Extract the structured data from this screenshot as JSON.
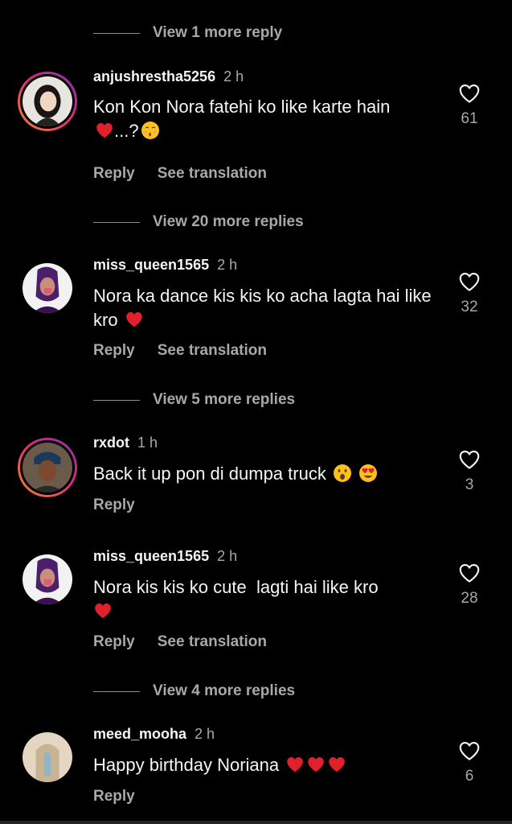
{
  "threads": [
    {
      "view_more": "View 1 more reply"
    },
    {
      "view_more": "View 20 more replies"
    },
    {
      "view_more": "View 5 more replies"
    },
    {
      "view_more": "View 4 more replies"
    }
  ],
  "comments": [
    {
      "username": "anjushrestha5256",
      "time": "2 h",
      "text_line1": "Kon Kon Nora fatehi ko like karte hain",
      "text_line2": "...?",
      "emojis": [
        "red-heart",
        "kissing-face-with-closed-eyes"
      ],
      "likes": "61",
      "reply": "Reply",
      "translate": "See translation",
      "avatar_ring": true
    },
    {
      "username": "miss_queen1565",
      "time": "2 h",
      "text": "Nora ka dance kis kis ko acha lagta hai like kro",
      "emojis": [
        "red-heart"
      ],
      "likes": "32",
      "reply": "Reply",
      "translate": "See translation",
      "avatar_ring": false
    },
    {
      "username": "rxdot",
      "time": "1 h",
      "text": "Back it up pon di dumpa truck",
      "emojis": [
        "face-with-open-mouth",
        "smiling-face-with-heart-eyes"
      ],
      "likes": "3",
      "reply": "Reply",
      "avatar_ring": true
    },
    {
      "username": "miss_queen1565",
      "time": "2 h",
      "text": "Nora kis kis ko cute  lagti hai like kro",
      "emojis": [
        "red-heart"
      ],
      "likes": "28",
      "reply": "Reply",
      "translate": "See translation",
      "avatar_ring": false
    },
    {
      "username": "meed_mooha",
      "time": "2 h",
      "text": "Happy birthday Noriana",
      "emojis": [
        "red-heart",
        "red-heart",
        "red-heart"
      ],
      "likes": "6",
      "reply": "Reply",
      "avatar_ring": false
    }
  ],
  "icons": {
    "like": "heart-outline-icon"
  },
  "colors": {
    "background": "#000000",
    "primary_text": "#f5f5f5",
    "secondary_text": "#a8a8a8",
    "heart": "#e0202a",
    "story_ring_start": "#f58529",
    "story_ring_end": "#8134af"
  }
}
